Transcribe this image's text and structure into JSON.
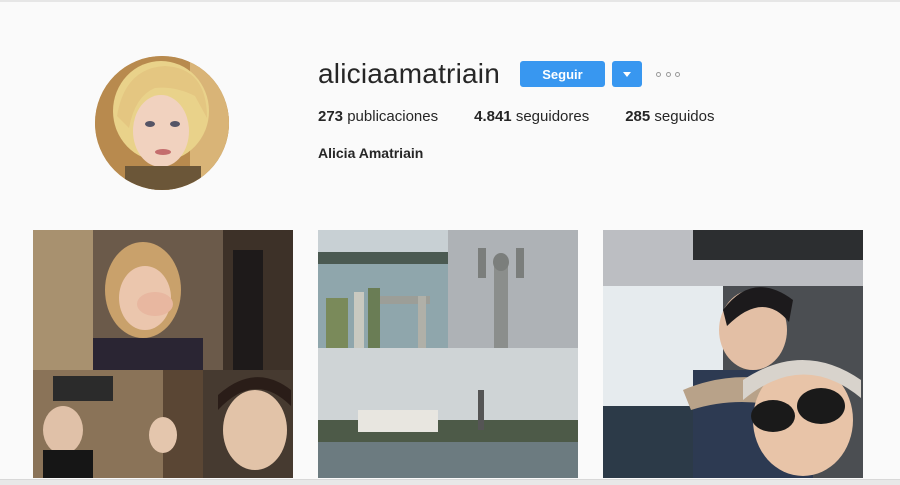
{
  "profile": {
    "username": "aliciaamatriain",
    "full_name": "Alicia Amatriain",
    "follow_label": "Seguir",
    "stats": [
      {
        "count": "273",
        "label": "publicaciones"
      },
      {
        "count": "4.841",
        "label": "seguidores"
      },
      {
        "count": "285",
        "label": "seguidos"
      }
    ]
  },
  "colors": {
    "accent": "#3897f0",
    "background": "#fafafa",
    "text": "#262626"
  },
  "icons": {
    "dropdown": "chevron-down-icon",
    "more": "more-options-icon"
  }
}
